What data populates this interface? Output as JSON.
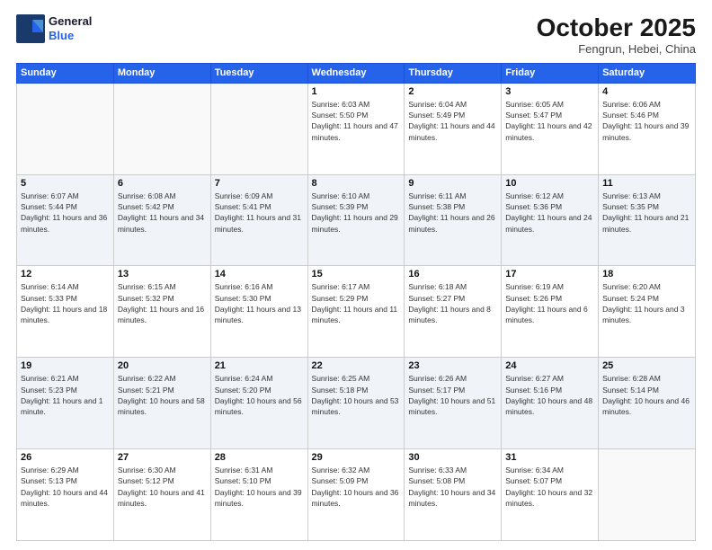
{
  "header": {
    "logo_line1": "General",
    "logo_line2": "Blue",
    "month_title": "October 2025",
    "subtitle": "Fengrun, Hebei, China"
  },
  "days_of_week": [
    "Sunday",
    "Monday",
    "Tuesday",
    "Wednesday",
    "Thursday",
    "Friday",
    "Saturday"
  ],
  "weeks": [
    [
      {
        "day": "",
        "sunrise": "",
        "sunset": "",
        "daylight": "",
        "empty": true
      },
      {
        "day": "",
        "sunrise": "",
        "sunset": "",
        "daylight": "",
        "empty": true
      },
      {
        "day": "",
        "sunrise": "",
        "sunset": "",
        "daylight": "",
        "empty": true
      },
      {
        "day": "1",
        "sunrise": "Sunrise: 6:03 AM",
        "sunset": "Sunset: 5:50 PM",
        "daylight": "Daylight: 11 hours and 47 minutes."
      },
      {
        "day": "2",
        "sunrise": "Sunrise: 6:04 AM",
        "sunset": "Sunset: 5:49 PM",
        "daylight": "Daylight: 11 hours and 44 minutes."
      },
      {
        "day": "3",
        "sunrise": "Sunrise: 6:05 AM",
        "sunset": "Sunset: 5:47 PM",
        "daylight": "Daylight: 11 hours and 42 minutes."
      },
      {
        "day": "4",
        "sunrise": "Sunrise: 6:06 AM",
        "sunset": "Sunset: 5:46 PM",
        "daylight": "Daylight: 11 hours and 39 minutes."
      }
    ],
    [
      {
        "day": "5",
        "sunrise": "Sunrise: 6:07 AM",
        "sunset": "Sunset: 5:44 PM",
        "daylight": "Daylight: 11 hours and 36 minutes."
      },
      {
        "day": "6",
        "sunrise": "Sunrise: 6:08 AM",
        "sunset": "Sunset: 5:42 PM",
        "daylight": "Daylight: 11 hours and 34 minutes."
      },
      {
        "day": "7",
        "sunrise": "Sunrise: 6:09 AM",
        "sunset": "Sunset: 5:41 PM",
        "daylight": "Daylight: 11 hours and 31 minutes."
      },
      {
        "day": "8",
        "sunrise": "Sunrise: 6:10 AM",
        "sunset": "Sunset: 5:39 PM",
        "daylight": "Daylight: 11 hours and 29 minutes."
      },
      {
        "day": "9",
        "sunrise": "Sunrise: 6:11 AM",
        "sunset": "Sunset: 5:38 PM",
        "daylight": "Daylight: 11 hours and 26 minutes."
      },
      {
        "day": "10",
        "sunrise": "Sunrise: 6:12 AM",
        "sunset": "Sunset: 5:36 PM",
        "daylight": "Daylight: 11 hours and 24 minutes."
      },
      {
        "day": "11",
        "sunrise": "Sunrise: 6:13 AM",
        "sunset": "Sunset: 5:35 PM",
        "daylight": "Daylight: 11 hours and 21 minutes."
      }
    ],
    [
      {
        "day": "12",
        "sunrise": "Sunrise: 6:14 AM",
        "sunset": "Sunset: 5:33 PM",
        "daylight": "Daylight: 11 hours and 18 minutes."
      },
      {
        "day": "13",
        "sunrise": "Sunrise: 6:15 AM",
        "sunset": "Sunset: 5:32 PM",
        "daylight": "Daylight: 11 hours and 16 minutes."
      },
      {
        "day": "14",
        "sunrise": "Sunrise: 6:16 AM",
        "sunset": "Sunset: 5:30 PM",
        "daylight": "Daylight: 11 hours and 13 minutes."
      },
      {
        "day": "15",
        "sunrise": "Sunrise: 6:17 AM",
        "sunset": "Sunset: 5:29 PM",
        "daylight": "Daylight: 11 hours and 11 minutes."
      },
      {
        "day": "16",
        "sunrise": "Sunrise: 6:18 AM",
        "sunset": "Sunset: 5:27 PM",
        "daylight": "Daylight: 11 hours and 8 minutes."
      },
      {
        "day": "17",
        "sunrise": "Sunrise: 6:19 AM",
        "sunset": "Sunset: 5:26 PM",
        "daylight": "Daylight: 11 hours and 6 minutes."
      },
      {
        "day": "18",
        "sunrise": "Sunrise: 6:20 AM",
        "sunset": "Sunset: 5:24 PM",
        "daylight": "Daylight: 11 hours and 3 minutes."
      }
    ],
    [
      {
        "day": "19",
        "sunrise": "Sunrise: 6:21 AM",
        "sunset": "Sunset: 5:23 PM",
        "daylight": "Daylight: 11 hours and 1 minute."
      },
      {
        "day": "20",
        "sunrise": "Sunrise: 6:22 AM",
        "sunset": "Sunset: 5:21 PM",
        "daylight": "Daylight: 10 hours and 58 minutes."
      },
      {
        "day": "21",
        "sunrise": "Sunrise: 6:24 AM",
        "sunset": "Sunset: 5:20 PM",
        "daylight": "Daylight: 10 hours and 56 minutes."
      },
      {
        "day": "22",
        "sunrise": "Sunrise: 6:25 AM",
        "sunset": "Sunset: 5:18 PM",
        "daylight": "Daylight: 10 hours and 53 minutes."
      },
      {
        "day": "23",
        "sunrise": "Sunrise: 6:26 AM",
        "sunset": "Sunset: 5:17 PM",
        "daylight": "Daylight: 10 hours and 51 minutes."
      },
      {
        "day": "24",
        "sunrise": "Sunrise: 6:27 AM",
        "sunset": "Sunset: 5:16 PM",
        "daylight": "Daylight: 10 hours and 48 minutes."
      },
      {
        "day": "25",
        "sunrise": "Sunrise: 6:28 AM",
        "sunset": "Sunset: 5:14 PM",
        "daylight": "Daylight: 10 hours and 46 minutes."
      }
    ],
    [
      {
        "day": "26",
        "sunrise": "Sunrise: 6:29 AM",
        "sunset": "Sunset: 5:13 PM",
        "daylight": "Daylight: 10 hours and 44 minutes."
      },
      {
        "day": "27",
        "sunrise": "Sunrise: 6:30 AM",
        "sunset": "Sunset: 5:12 PM",
        "daylight": "Daylight: 10 hours and 41 minutes."
      },
      {
        "day": "28",
        "sunrise": "Sunrise: 6:31 AM",
        "sunset": "Sunset: 5:10 PM",
        "daylight": "Daylight: 10 hours and 39 minutes."
      },
      {
        "day": "29",
        "sunrise": "Sunrise: 6:32 AM",
        "sunset": "Sunset: 5:09 PM",
        "daylight": "Daylight: 10 hours and 36 minutes."
      },
      {
        "day": "30",
        "sunrise": "Sunrise: 6:33 AM",
        "sunset": "Sunset: 5:08 PM",
        "daylight": "Daylight: 10 hours and 34 minutes."
      },
      {
        "day": "31",
        "sunrise": "Sunrise: 6:34 AM",
        "sunset": "Sunset: 5:07 PM",
        "daylight": "Daylight: 10 hours and 32 minutes."
      },
      {
        "day": "",
        "sunrise": "",
        "sunset": "",
        "daylight": "",
        "empty": true
      }
    ]
  ]
}
